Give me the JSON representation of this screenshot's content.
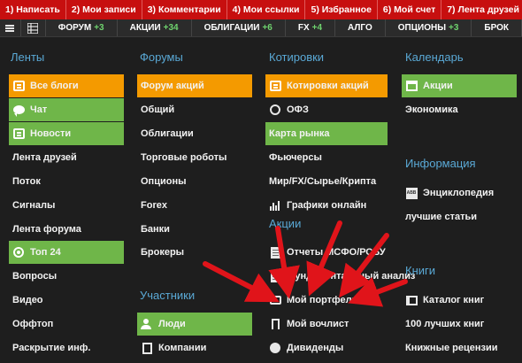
{
  "topbar": [
    {
      "label": "1) Написать"
    },
    {
      "label": "2) Мои записи"
    },
    {
      "label": "3) Комментарии"
    },
    {
      "label": "4) Мои ссылки"
    },
    {
      "label": "5) Избранное"
    },
    {
      "label": "6) Мой счет"
    },
    {
      "label": "7) Лента друзей"
    }
  ],
  "navbar": [
    {
      "label": "ФОРУМ",
      "count": "+3"
    },
    {
      "label": "АКЦИИ",
      "count": "+34"
    },
    {
      "label": "ОБЛИГАЦИИ",
      "count": "+6"
    },
    {
      "label": "FX",
      "count": "+4"
    },
    {
      "label": "АЛГО",
      "count": ""
    },
    {
      "label": "ОПЦИОНЫ",
      "count": "+3"
    },
    {
      "label": "БРОК",
      "count": ""
    }
  ],
  "col1": {
    "title": "Ленты",
    "items": [
      {
        "label": "Все блоги",
        "icon": "feed-icon"
      },
      {
        "label": "Чат",
        "icon": "chat-icon"
      },
      {
        "label": "Новости",
        "icon": "news-icon"
      },
      {
        "label": "Лента друзей"
      },
      {
        "label": "Поток"
      },
      {
        "label": "Сигналы"
      },
      {
        "label": "Лента форума"
      },
      {
        "label": "Топ 24",
        "icon": "award-icon"
      },
      {
        "label": "Вопросы"
      },
      {
        "label": "Видео"
      },
      {
        "label": "Оффтоп"
      },
      {
        "label": "Раскрытие инф."
      }
    ]
  },
  "col2": {
    "title": "Форумы",
    "items": [
      {
        "label": "Форум акций"
      },
      {
        "label": "Общий"
      },
      {
        "label": "Облигации"
      },
      {
        "label": "Торговые роботы"
      },
      {
        "label": "Опционы"
      },
      {
        "label": "Forex"
      },
      {
        "label": "Банки"
      },
      {
        "label": "Брокеры"
      }
    ],
    "title2": "Участники",
    "items2": [
      {
        "label": "Люди",
        "icon": "people-icon"
      },
      {
        "label": "Компании",
        "icon": "building-icon"
      }
    ]
  },
  "col3": {
    "title": "Котировки",
    "items": [
      {
        "label": "Котировки акций",
        "icon": "quotes-icon"
      },
      {
        "label": "ОФЗ",
        "icon": "ofz-icon"
      },
      {
        "label": "Карта рынка"
      },
      {
        "label": "Фьючерсы"
      },
      {
        "label": "Мир/FX/Сырье/Крипта"
      },
      {
        "label": "Графики онлайн",
        "icon": "chart-icon"
      }
    ],
    "title2": "Акции",
    "items2": [
      {
        "label": "Отчеты МСФО/РСБУ",
        "icon": "pdf-icon"
      },
      {
        "label": "Фундаментальный анализ",
        "icon": "fund-icon"
      },
      {
        "label": "Мой портфель",
        "icon": "briefcase-icon"
      },
      {
        "label": "Мой вочлист",
        "icon": "bookmark-icon"
      },
      {
        "label": "Дивиденды",
        "icon": "coin-icon"
      }
    ]
  },
  "col4": {
    "title": "Календарь",
    "items": [
      {
        "label": "Акции",
        "icon": "calendar-icon"
      },
      {
        "label": "Экономика"
      }
    ],
    "title2": "Информация",
    "items2": [
      {
        "label": "Энциклопедия",
        "icon": "encyclopedia-icon",
        "icon_text": "ABB"
      },
      {
        "label": "лучшие статьи"
      }
    ],
    "title3": "Книги",
    "items3": [
      {
        "label": "Каталог книг",
        "icon": "book-icon"
      },
      {
        "label": "100 лучших книг"
      },
      {
        "label": "Книжные рецензии"
      }
    ]
  },
  "colors": {
    "topbar": "#c70f0f",
    "active_orange": "#f49a00",
    "active_green": "#6fb649",
    "heading_blue": "#5aa9d6",
    "arrow_red": "#e0141a",
    "nav_count_green": "#6ed36e"
  }
}
